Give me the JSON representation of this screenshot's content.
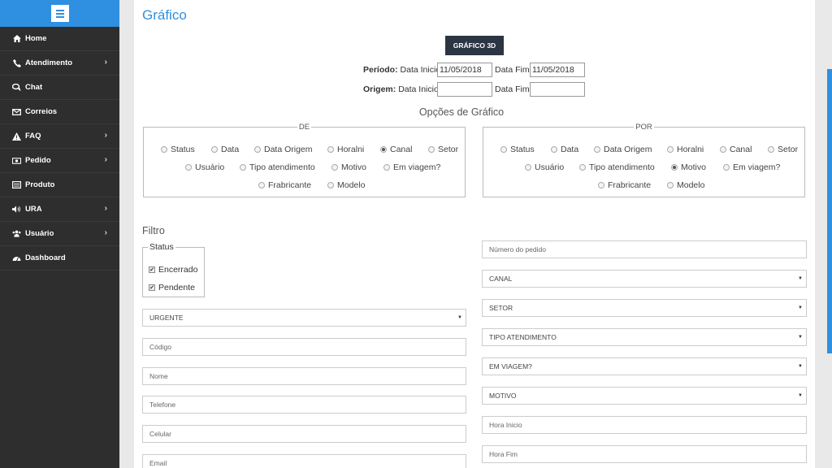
{
  "sidebar": {
    "items": [
      {
        "label": "Home",
        "icon": "home-icon",
        "has_submenu": false
      },
      {
        "label": "Atendimento",
        "icon": "phone-icon",
        "has_submenu": true
      },
      {
        "label": "Chat",
        "icon": "chat-icon",
        "has_submenu": false
      },
      {
        "label": "Correios",
        "icon": "envelope-icon",
        "has_submenu": false
      },
      {
        "label": "FAQ",
        "icon": "warning-icon",
        "has_submenu": true
      },
      {
        "label": "Pedido",
        "icon": "money-icon",
        "has_submenu": true
      },
      {
        "label": "Produto",
        "icon": "list-icon",
        "has_submenu": false
      },
      {
        "label": "URA",
        "icon": "volume-icon",
        "has_submenu": true
      },
      {
        "label": "Usuário",
        "icon": "users-icon",
        "has_submenu": true
      },
      {
        "label": "Dashboard",
        "icon": "dashboard-icon",
        "has_submenu": false
      }
    ],
    "colors": {
      "top": "#2f8fe0",
      "background": "#2e2e2e"
    }
  },
  "page": {
    "title": "Gráfico",
    "button_3d": "GRÁFICO 3D",
    "periodo": {
      "label": "Período:",
      "inicio_label": "Data Inicio",
      "inicio_value": "11/05/2018",
      "fim_label": "Data Fim",
      "fim_value": "11/05/2018"
    },
    "origem": {
      "label": "Origem:",
      "inicio_label": "Data Inicio",
      "inicio_value": "",
      "fim_label": "Data Fim",
      "fim_value": ""
    },
    "options_title": "Opções de Gráfico",
    "de": {
      "legend": "DE",
      "options": [
        "Status",
        "Data",
        "Data Origem",
        "Horalni",
        "Canal",
        "Setor",
        "Usuário",
        "Tipo atendimento",
        "Motivo",
        "Em viagem?",
        "Frabricante",
        "Modelo"
      ],
      "selected": "Canal"
    },
    "por": {
      "legend": "POR",
      "options": [
        "Status",
        "Data",
        "Data Origem",
        "Horalni",
        "Canal",
        "Setor",
        "Usuário",
        "Tipo atendimento",
        "Motivo",
        "Em viagem?",
        "Frabricante",
        "Modelo"
      ],
      "selected": "Motivo"
    },
    "filter_title": "Filtro",
    "status": {
      "legend": "Status",
      "options": [
        {
          "label": "Encerrado",
          "checked": true
        },
        {
          "label": "Pendente",
          "checked": true
        }
      ]
    },
    "left_fields": {
      "priority_select": "URGENTE",
      "codigo": "Código",
      "nome": "Nome",
      "telefone": "Telefone",
      "celular": "Celular",
      "email": "Email"
    },
    "right_fields": {
      "numero_pedido": "Número do pedido",
      "canal": "CANAL",
      "setor": "SETOR",
      "tipo_atendimento": "TIPO ATENDIMENTO",
      "em_viagem": "EM VIAGEM?",
      "motivo": "MOTIVO",
      "hora_inicio": "Hora Inicio",
      "hora_fim": "Hora Fim"
    }
  }
}
